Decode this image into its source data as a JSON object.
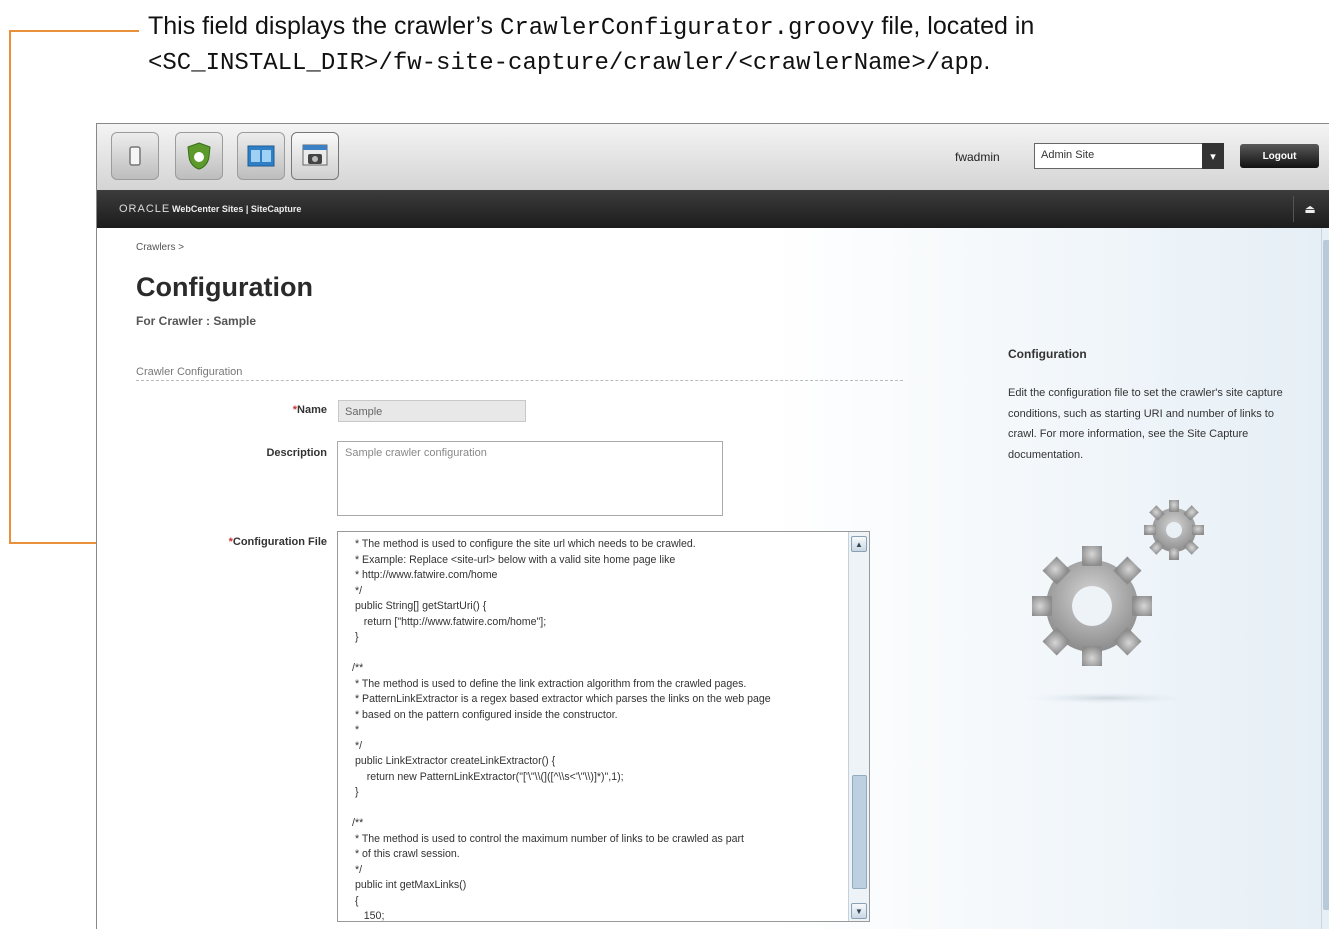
{
  "callout": {
    "prefix": "This field displays the crawler’s ",
    "filename": "CrawlerConfigurator.groovy",
    "middle": " file, located in",
    "path": "<SC_INSTALL_DIR>/fw-site-capture/crawler/<crawlerName>/app",
    "suffix": "."
  },
  "topbar": {
    "apps": [
      "power-icon",
      "shield-icon",
      "dashboard-icon",
      "site-capture-icon"
    ],
    "username": "fwadmin",
    "site_selected": "Admin Site",
    "logout_label": "Logout"
  },
  "brand": {
    "logo": "ORACLE",
    "product": "WebCenter Sites | SiteCapture"
  },
  "page": {
    "breadcrumb": "Crawlers >",
    "title": "Configuration",
    "subtitle": "For Crawler : Sample",
    "section": "Crawler Configuration"
  },
  "form": {
    "name_label": "Name",
    "name_value": "Sample",
    "description_label": "Description",
    "description_value": "Sample crawler configuration",
    "config_label": "Configuration File",
    "required_marker": "*",
    "config_text": " * The method is used to configure the site url which needs to be crawled.\n * Example: Replace <site-url> below with a valid site home page like\n * http://www.fatwire.com/home\n */\n public String[] getStartUri() {\n    return [\"http://www.fatwire.com/home\"];\n }\n\n/**\n * The method is used to define the link extraction algorithm from the crawled pages.\n * PatternLinkExtractor is a regex based extractor which parses the links on the web page\n * based on the pattern configured inside the constructor.\n *\n */\n public LinkExtractor createLinkExtractor() {\n     return new PatternLinkExtractor(\"['\\\"\\\\(]([^\\\\s<'\\\"\\\\)]*)\",1);\n }\n\n/**\n * The method is used to control the maximum number of links to be crawled as part\n * of this crawl session.\n */\n public int getMaxLinks()\n {\n    150;"
  },
  "sidebar": {
    "title": "Configuration",
    "body": "Edit the configuration file to set the crawler's site capture conditions, such as starting URI and number of links to crawl. For more information, see the Site Capture documentation."
  },
  "colors": {
    "callout_line": "#e8913a",
    "brand_bar": "#1c1c1c",
    "required": "#cc3333"
  }
}
